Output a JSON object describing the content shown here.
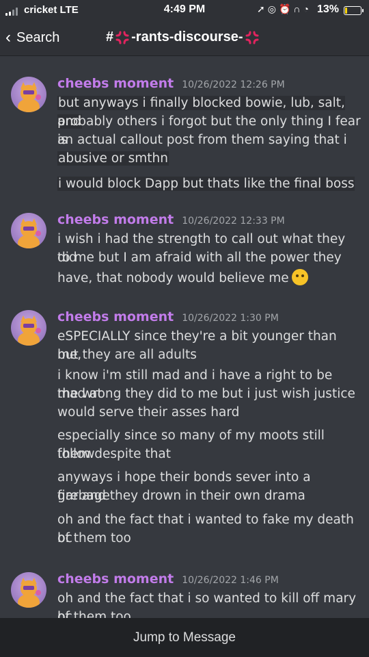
{
  "status_bar": {
    "carrier": "cricket LTE",
    "time": "4:49 PM",
    "battery_percent": "13%",
    "battery_level": 0.13,
    "icons": [
      "location-arrow-icon",
      "lock-rotation-icon",
      "alarm-icon",
      "headphones-icon",
      "wifi-icon"
    ]
  },
  "header": {
    "back_label": "Search",
    "channel_prefix": "#",
    "channel_name": "-rants-discourse-",
    "channel_icon": "anger-symbol-emoji"
  },
  "messages": [
    {
      "author": "cheebs moment",
      "timestamp": "10/26/2022 12:26 PM",
      "lines": [
        "but anyways i finally blocked bowie, lub, salt, and",
        "probably others i forgot but the only thing I fear is",
        "an actual callout post from them saying that i am",
        "abusive or smthn",
        "i would block Dapp but thats like the final boss"
      ]
    },
    {
      "author": "cheebs moment",
      "timestamp": "10/26/2022 12:33 PM",
      "lines": [
        "i wish i had the strength to call out what they did",
        "to me but I am afraid with all the power they",
        "have, that nobody would believe me"
      ]
    },
    {
      "author": "cheebs moment",
      "timestamp": "10/26/2022 1:30 PM",
      "lines": [
        "eSPECIALLY since they're a bit younger than me,",
        "but they are all adults",
        "i know i'm still mad and i have a right to be mad at",
        "the wrong they did to me but i just wish justice",
        "would serve their asses hard",
        "especially since so many of my moots still follow",
        "them despite that",
        "anyways i hope their bonds sever into a garbage",
        "fire and they drown in their own drama",
        "oh and the fact that i wanted to fake my death bc",
        "of them too"
      ]
    },
    {
      "author": "cheebs moment",
      "timestamp": "10/26/2022 1:46 PM",
      "lines": [
        "oh and the fact that i so wanted to kill off mary bc",
        "of them too"
      ]
    }
  ],
  "jump_bar": {
    "label": "Jump to Message"
  },
  "colors": {
    "background": "#36393f",
    "header": "#2f3136",
    "author": "#c27cea",
    "text": "#dcddde",
    "timestamp": "#a3a6aa",
    "jump_bar": "#202225"
  }
}
